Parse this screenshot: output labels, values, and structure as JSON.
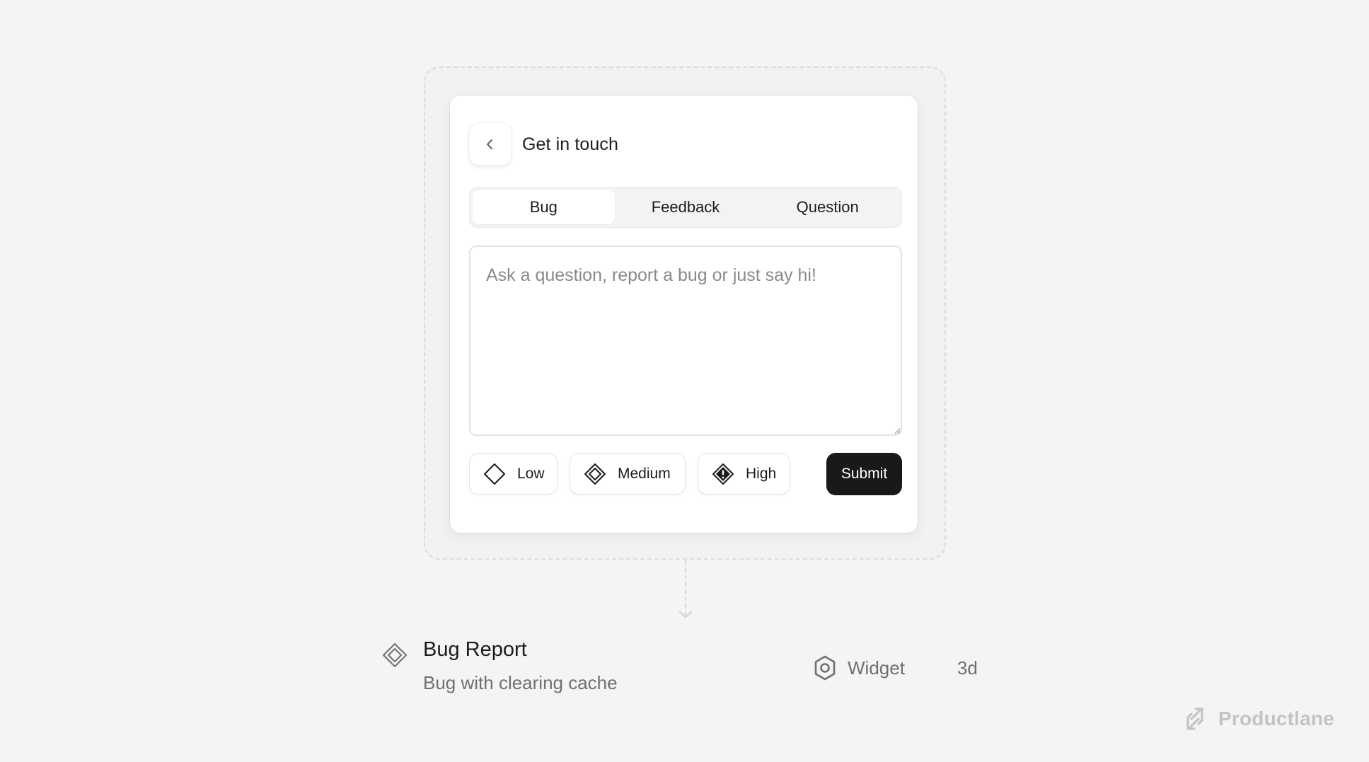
{
  "widget": {
    "title": "Get in touch",
    "tabs": [
      {
        "label": "Bug",
        "active": true
      },
      {
        "label": "Feedback",
        "active": false
      },
      {
        "label": "Question",
        "active": false
      }
    ],
    "message": {
      "value": "",
      "placeholder": "Ask a question, report a bug or just say hi!"
    },
    "priorities": [
      {
        "label": "Low",
        "icon": "diamond-outline-icon"
      },
      {
        "label": "Medium",
        "icon": "diamond-double-icon"
      },
      {
        "label": "High",
        "icon": "diamond-alert-icon"
      }
    ],
    "submit_label": "Submit"
  },
  "result": {
    "icon": "diamond-double-icon",
    "title": "Bug Report",
    "subtitle": "Bug with clearing cache",
    "source_icon": "hexagon-widget-icon",
    "source": "Widget",
    "age": "3d"
  },
  "brand": {
    "icon": "productlane-arrows-icon",
    "name": "Productlane"
  },
  "colors": {
    "background": "#f4f4f4",
    "card": "#ffffff",
    "primary_button": "#19191b",
    "muted_text": "#6f6f75",
    "brand_text": "#c4c4c4"
  }
}
